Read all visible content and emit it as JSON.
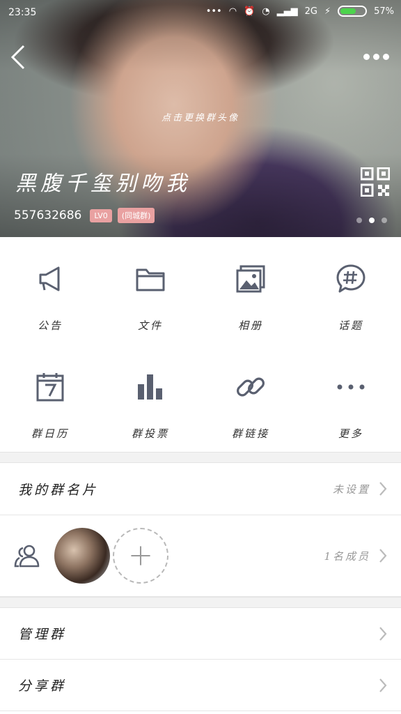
{
  "status_bar": {
    "time": "23:35",
    "battery": "57%",
    "network": "2G"
  },
  "header": {
    "change_avatar_hint": "点击更换群头像",
    "group_name": "黑腹千玺别吻我",
    "group_id": "557632686",
    "level_tag": "LV0",
    "type_tag": "(同城群)",
    "slide_count": 3,
    "active_slide": 2
  },
  "grid": {
    "items": [
      {
        "label": "公告",
        "icon": "megaphone-icon"
      },
      {
        "label": "文件",
        "icon": "folder-icon"
      },
      {
        "label": "相册",
        "icon": "album-icon"
      },
      {
        "label": "话题",
        "icon": "hashtag-bubble-icon"
      },
      {
        "label": "群日历",
        "icon": "calendar-icon"
      },
      {
        "label": "群投票",
        "icon": "bar-chart-icon"
      },
      {
        "label": "群链接",
        "icon": "link-icon"
      },
      {
        "label": "更多",
        "icon": "more-dots-icon"
      }
    ]
  },
  "card": {
    "title": "我的群名片",
    "value": "未设置"
  },
  "members": {
    "count_text": "1名成员"
  },
  "menu": {
    "manage": "管理群",
    "share": "分享群"
  },
  "colors": {
    "icon": "#5a6070",
    "tag": "#e9a1a1",
    "separator": "#f2f2f2"
  }
}
